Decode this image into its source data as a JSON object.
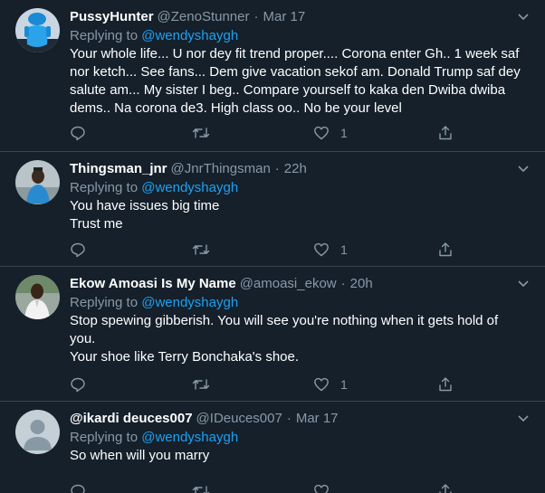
{
  "tweets": [
    {
      "name": "PussyHunter",
      "handle": "@ZenoStunner",
      "dot": "·",
      "time": "Mar 17",
      "replying_prefix": "Replying to ",
      "replying_to": "@wendyshaygh",
      "lines": [
        "Your whole life... U nor dey fit trend proper.... Corona enter Gh.. 1 week saf",
        "nor ketch... See fans... Dem give vacation sekof am. Donald Trump saf dey",
        "salute am... My sister I beg.. Compare yourself to kaka den Dwiba dwiba",
        "dems.. Na corona de3. High class oo.. No be your level"
      ],
      "likes": "1",
      "avatar_icon": "blue-figure-avatar"
    },
    {
      "name": "Thingsman_jnr",
      "handle": "@JnrThingsman",
      "dot": "·",
      "time": "22h",
      "replying_prefix": "Replying to ",
      "replying_to": "@wendyshaygh",
      "lines": [
        "You have issues big time",
        "Trust me"
      ],
      "likes": "1",
      "avatar_icon": "photo-avatar"
    },
    {
      "name": "Ekow Amoasi Is My Name",
      "handle": "@amoasi_ekow",
      "dot": "·",
      "time": "20h",
      "replying_prefix": "Replying to ",
      "replying_to": "@wendyshaygh",
      "lines": [
        "Stop spewing gibberish. You will see you're nothing when it gets hold of",
        "you.",
        "Your shoe like Terry Bonchaka's shoe."
      ],
      "likes": "1",
      "avatar_icon": "photo-avatar"
    },
    {
      "name": "@ikardi deuces007",
      "handle": "@IDeuces007",
      "dot": "·",
      "time": "Mar 17",
      "replying_prefix": "Replying to ",
      "replying_to": "@wendyshaygh",
      "lines": [
        "So when will you marry"
      ],
      "likes": "",
      "avatar_icon": "default-profile-avatar"
    }
  ],
  "colors": {
    "background": "#15202b",
    "divider": "#38444d",
    "text": "#ffffff",
    "muted": "#8899a6",
    "link": "#1da1f2"
  }
}
